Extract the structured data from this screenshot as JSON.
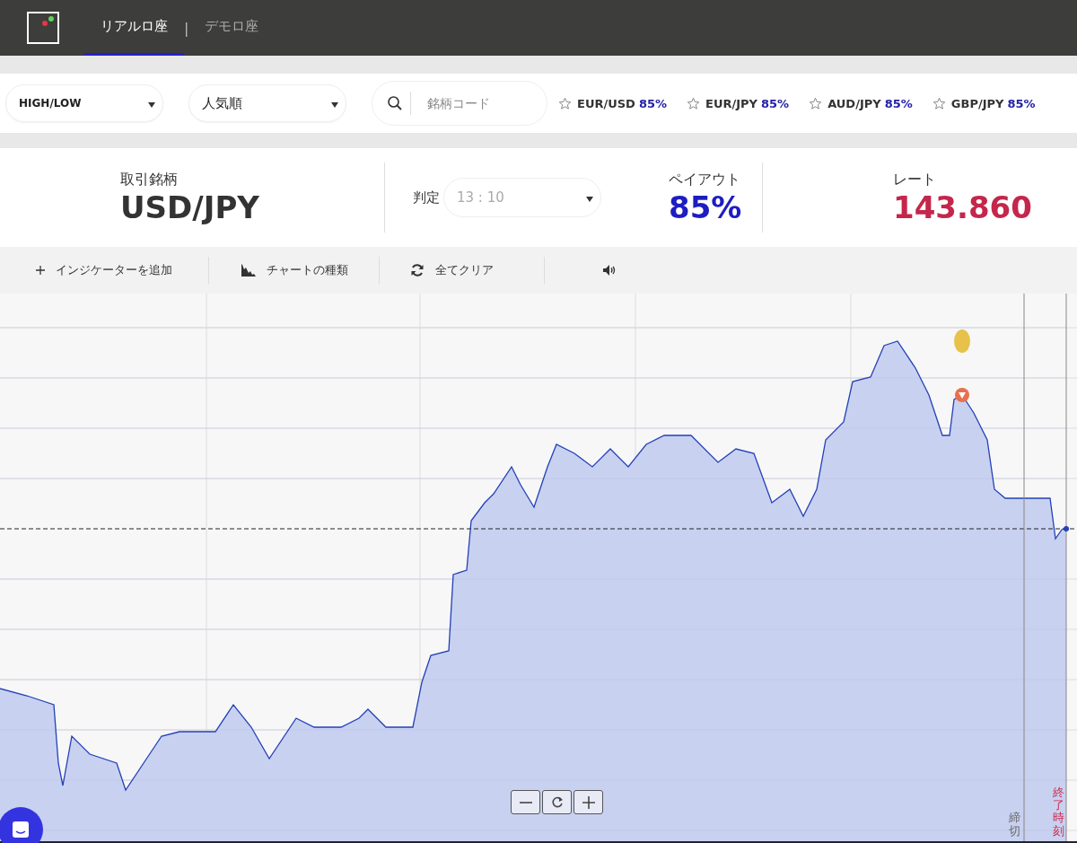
{
  "header": {
    "tabs": [
      {
        "label": "リアルロ座",
        "selected": true
      },
      {
        "label": "デモロ座",
        "selected": false
      }
    ],
    "separator": "|"
  },
  "filters": {
    "dropdowns": [
      {
        "value": "HIGH/LOW"
      },
      {
        "value": "人気順"
      }
    ],
    "search": {
      "placeholder": "銘柄コード"
    },
    "favorites": [
      {
        "pair": "EUR/USD",
        "payout": "85%",
        "starred": false
      },
      {
        "pair": "EUR/JPY",
        "payout": "85%",
        "starred": false
      },
      {
        "pair": "AUD/JPY",
        "payout": "85%",
        "starred": false
      },
      {
        "pair": "GBP/JPY",
        "payout": "85%",
        "starred": false
      }
    ]
  },
  "info": {
    "symbol_label": "取引銘柄",
    "symbol": "USD/JPY",
    "judge_label": "判定",
    "judge_time": {
      "placeholder": "13 : 10"
    },
    "payout_label": "ペイアウト",
    "payout": "85%",
    "rate_label": "レート",
    "rate": "143.860"
  },
  "toolbar": [
    {
      "kind": "add",
      "label": "インジケーターを追加"
    },
    {
      "kind": "chart",
      "label": "チャートの種類"
    },
    {
      "kind": "clear",
      "label": "全てクリア"
    },
    {
      "kind": "sound"
    }
  ],
  "chart": {
    "deadline_label": "締切",
    "end_label": "終了時刻"
  }
}
